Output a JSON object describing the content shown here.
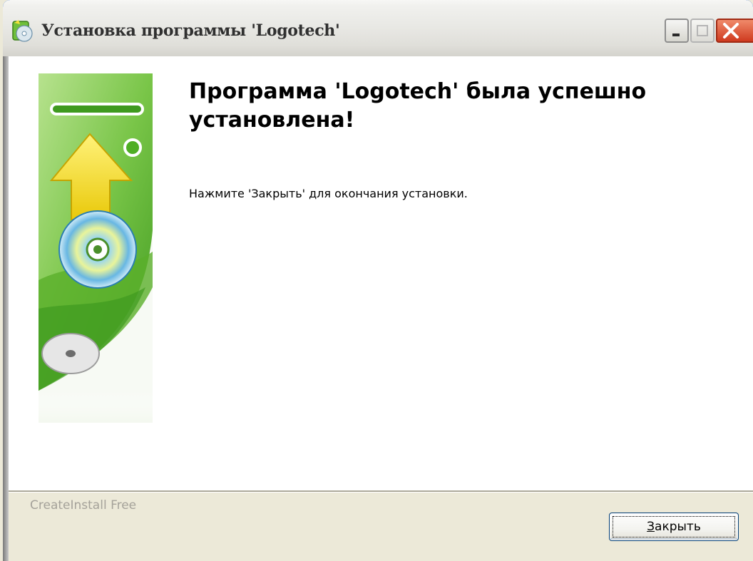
{
  "window": {
    "title": "Установка программы 'Logotech'"
  },
  "content": {
    "heading": "Программа 'Logotech' была успешно установлена!",
    "instruction": "Нажмите 'Закрыть' для окончания установки."
  },
  "footer": {
    "brand": "CreateInstall Free",
    "close_button": {
      "accel": "З",
      "rest": "акрыть"
    }
  },
  "colors": {
    "titlebar": "#e9e9e5",
    "close_caption": "#d9532e",
    "banner_green": "#5cb82d",
    "arrow_yellow": "#f2e13a"
  },
  "icons": {
    "title": "installer-cd-icon",
    "minimize": "minimize-icon",
    "maximize": "maximize-icon",
    "close": "close-icon"
  }
}
